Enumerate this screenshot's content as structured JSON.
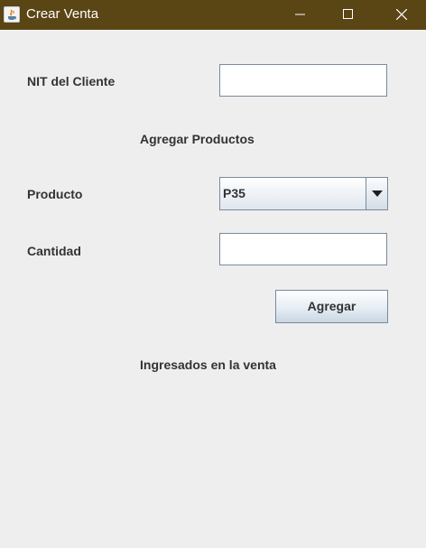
{
  "window": {
    "title": "Crear Venta",
    "titlebar_color": "#5a4515",
    "icon": "java-icon",
    "controls": [
      "minimize-icon",
      "maximize-icon",
      "close-icon"
    ]
  },
  "form": {
    "nit_label": "NIT del Cliente",
    "nit_value": "",
    "section_add_products": "Agregar Productos",
    "producto_label": "Producto",
    "producto_selected": "P35",
    "cantidad_label": "Cantidad",
    "cantidad_value": "",
    "add_button_label": "Agregar",
    "section_added": "Ingresados en la venta"
  }
}
